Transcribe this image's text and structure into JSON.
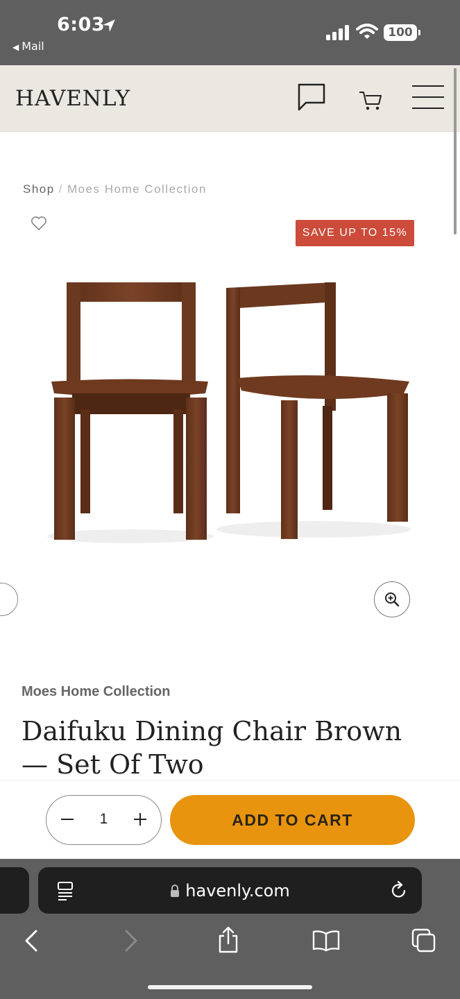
{
  "status_bar": {
    "time": "6:03",
    "back_label": "Mail",
    "battery": "100"
  },
  "header": {
    "logo": "HAVENLY"
  },
  "breadcrumb": {
    "shop": "Shop",
    "separator": "/",
    "collection": "Moes Home Collection"
  },
  "product": {
    "badge": "SAVE UP TO 15%",
    "brand": "Moes Home Collection",
    "title": "Daifuku Dining Chair Brown — Set Of Two",
    "image_icon": "dining-chair-pair"
  },
  "cart_bar": {
    "quantity": "1",
    "add_to_cart_label": "ADD TO CART"
  },
  "browser": {
    "url": "havenly.com"
  },
  "colors": {
    "status_bar": "#5f5f5f",
    "header_bg": "#ebe8e1",
    "sale_badge": "#cc4b3a",
    "add_to_cart": "#e8940f",
    "address_bar": "#1f1f1f"
  }
}
